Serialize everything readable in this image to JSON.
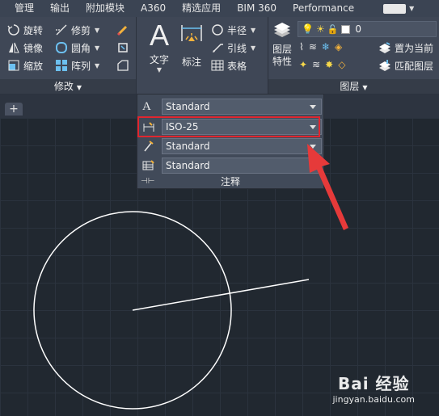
{
  "menubar": {
    "items": [
      "管理",
      "输出",
      "附加模块",
      "A360",
      "精选应用",
      "BIM 360",
      "Performance"
    ]
  },
  "modify_panel": {
    "tools": [
      {
        "label": "旋转",
        "icon": "rotate-icon"
      },
      {
        "label": "修剪",
        "icon": "trim-icon"
      },
      {
        "label": "镜像",
        "icon": "mirror-icon"
      },
      {
        "label": "圆角",
        "icon": "fillet-icon"
      },
      {
        "label": "缩放",
        "icon": "scale-icon"
      },
      {
        "label": "阵列",
        "icon": "array-icon"
      }
    ],
    "footer": "修改"
  },
  "annotation_panel": {
    "text_label": "文字",
    "dimension_label": "标注",
    "radius_label": "半径",
    "leader_label": "引线",
    "table_label": "表格",
    "footer": "注释"
  },
  "layers_panel": {
    "properties_label": "图层\n特性",
    "properties_line1": "图层",
    "properties_line2": "特性",
    "current_layer": "0",
    "set_current_label": "置为当前",
    "match_layer_label": "匹配图层",
    "footer": "图层"
  },
  "flyout": {
    "rows": [
      {
        "value": "Standard",
        "icon": "text-style-icon"
      },
      {
        "value": "ISO-25",
        "icon": "dimension-style-icon"
      },
      {
        "value": "Standard",
        "icon": "multileader-style-icon"
      },
      {
        "value": "Standard",
        "icon": "table-style-icon"
      }
    ],
    "footer": "注释"
  },
  "tabs": {
    "new_tab": "+"
  },
  "watermark": {
    "logo": "Bai 经验",
    "url": "jingyan.baidu.com"
  },
  "colors": {
    "canvas_bg": "#212830",
    "ribbon_bg": "#3f4756",
    "highlight_red": "#e0262f",
    "arrow_red": "#e63a3a",
    "drawing_line": "#ffffff"
  }
}
